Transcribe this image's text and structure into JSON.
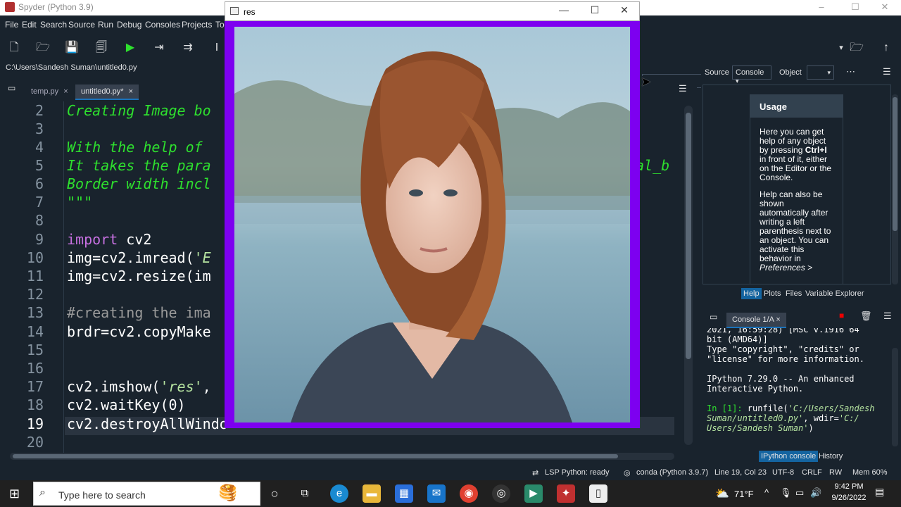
{
  "app": {
    "title": "Spyder (Python 3.9)",
    "window_controls": [
      "–",
      "☐",
      "✕"
    ]
  },
  "menu": [
    "File",
    "Edit",
    "Search",
    "Source",
    "Run",
    "Debug",
    "Consoles",
    "Projects",
    "To"
  ],
  "file_path": "C:\\Users\\Sandesh Suman\\untitled0.py",
  "editor": {
    "tabs": [
      {
        "label": "temp.py",
        "close": "×"
      },
      {
        "label": "untitled0.py*",
        "close": "×"
      }
    ],
    "current_line": 19,
    "lines": [
      {
        "n": "2",
        "text": "Creating Image bo"
      },
      {
        "n": "3",
        "text": ""
      },
      {
        "n": "4",
        "text": "With the help of"
      },
      {
        "n": "5",
        "text": "It takes the para"
      },
      {
        "n": "5b",
        "text": "al_b"
      },
      {
        "n": "6",
        "text": "Border width incl"
      },
      {
        "n": "7",
        "text": "\"\"\""
      },
      {
        "n": "8",
        "text": ""
      },
      {
        "n": "9a",
        "text": "import"
      },
      {
        "n": "9b",
        "text": " cv2"
      },
      {
        "n": "10a",
        "text": "img=cv2.imread("
      },
      {
        "n": "10b",
        "text": "'E"
      },
      {
        "n": "11",
        "text": "img=cv2.resize(im"
      },
      {
        "n": "12",
        "text": ""
      },
      {
        "n": "13",
        "text": "#creating the ima"
      },
      {
        "n": "14",
        "text": "brdr=cv2.copyMake"
      },
      {
        "n": "15",
        "text": ""
      },
      {
        "n": "16",
        "text": ""
      },
      {
        "n": "17a",
        "text": "cv2.imshow("
      },
      {
        "n": "17b",
        "text": "'res'"
      },
      {
        "n": "17c",
        "text": ","
      },
      {
        "n": "18",
        "text": "cv2.waitKey(0)"
      },
      {
        "n": "19",
        "text": "cv2.destroyAllWindo"
      },
      {
        "n": "20",
        "text": ""
      }
    ],
    "line_numbers": [
      "2",
      "3",
      "4",
      "5",
      "6",
      "7",
      "8",
      "9",
      "10",
      "11",
      "12",
      "13",
      "14",
      "15",
      "16",
      "17",
      "18",
      "19",
      "20"
    ]
  },
  "help_pane": {
    "source_label": "Source",
    "source_value": "Console",
    "object_label": "Object",
    "usage_title": "Usage",
    "usage_p1_a": "Here you can get help of any object by pressing ",
    "usage_p1_key": "Ctrl+I",
    "usage_p1_b": " in front of it, either on the Editor or the Console.",
    "usage_p2_a": "Help can also be shown automatically after writing a left parenthesis next to an object. You can activate this behavior in ",
    "usage_p2_em": "Preferences >",
    "tabs": [
      "Help",
      "Plots",
      "Files",
      "Variable Explorer"
    ]
  },
  "console": {
    "tab_label": "Console 1/A",
    "line0": "2021, 16:59:28) [MSC v.1916 64",
    "line1": "bit (AMD64)]",
    "line2": "Type \"copyright\", \"credits\" or",
    "line3": "\"license\" for more information.",
    "line4": "IPython 7.29.0 -- An enhanced",
    "line5": "Interactive Python.",
    "prompt": "In [1]:",
    "cmd_a": " runfile(",
    "cmd_s1": "'C:/Users/Sandesh",
    "cmd_s2": "Suman/untitled0.py'",
    "cmd_b": ", wdir=",
    "cmd_s3": "'C:/",
    "cmd_s4": "Users/Sandesh Suman'",
    "cmd_c": ")",
    "tabs": [
      "IPython console",
      "History"
    ]
  },
  "statusbar": {
    "lsp": "LSP Python: ready",
    "conda": "conda (Python 3.9.7)",
    "position": "Line 19, Col 23",
    "encoding": "UTF-8",
    "eol": "CRLF",
    "rw": "RW",
    "mem": "Mem 60%"
  },
  "res_window": {
    "title": "res",
    "controls": [
      "—",
      "☐",
      "✕"
    ],
    "border_color": "#7d00f0"
  },
  "taskbar": {
    "search_placeholder": "Type here to search",
    "weather": "71°F",
    "time": "9:42 PM",
    "date": "9/26/2022"
  }
}
